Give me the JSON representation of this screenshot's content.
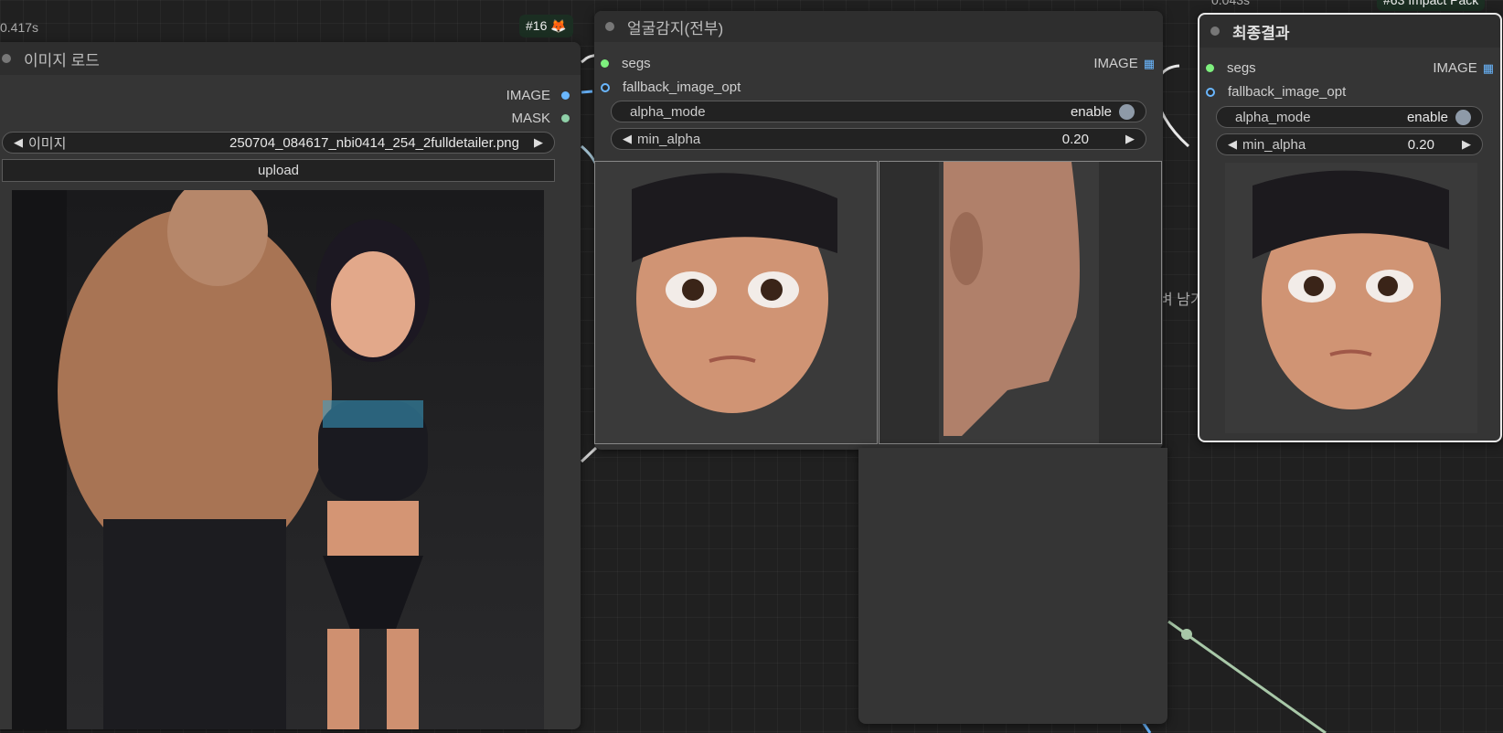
{
  "timing_left": "0.417s",
  "timing_right": "0.043s",
  "badge_left": "#16",
  "badge_left_icon": "fox-icon",
  "badge_right": "#63 Impact Pack",
  "hidden_text": "벼 남기",
  "node_load": {
    "title": "이미지 로드",
    "outputs": [
      "IMAGE",
      "MASK"
    ],
    "image_widget": {
      "label": "이미지",
      "value": "250704_084617_nbi0414_254_2fulldetailer.png"
    },
    "upload_label": "upload"
  },
  "node_face": {
    "title": "얼굴감지(전부)",
    "inputs": [
      "segs",
      "fallback_image_opt"
    ],
    "output": "IMAGE",
    "alpha_mode": {
      "label": "alpha_mode",
      "value": "enable"
    },
    "min_alpha": {
      "label": "min_alpha",
      "value": "0.20"
    }
  },
  "node_final": {
    "title": "최종결과",
    "inputs": [
      "segs",
      "fallback_image_opt"
    ],
    "output": "IMAGE",
    "alpha_mode": {
      "label": "alpha_mode",
      "value": "enable"
    },
    "min_alpha": {
      "label": "min_alpha",
      "value": "0.20"
    }
  },
  "colors": {
    "canvas": "#202020",
    "node": "#353535",
    "link_green": "#a8c8a8",
    "socket_blue": "#6ab7ff",
    "socket_green": "#7ef07e"
  }
}
